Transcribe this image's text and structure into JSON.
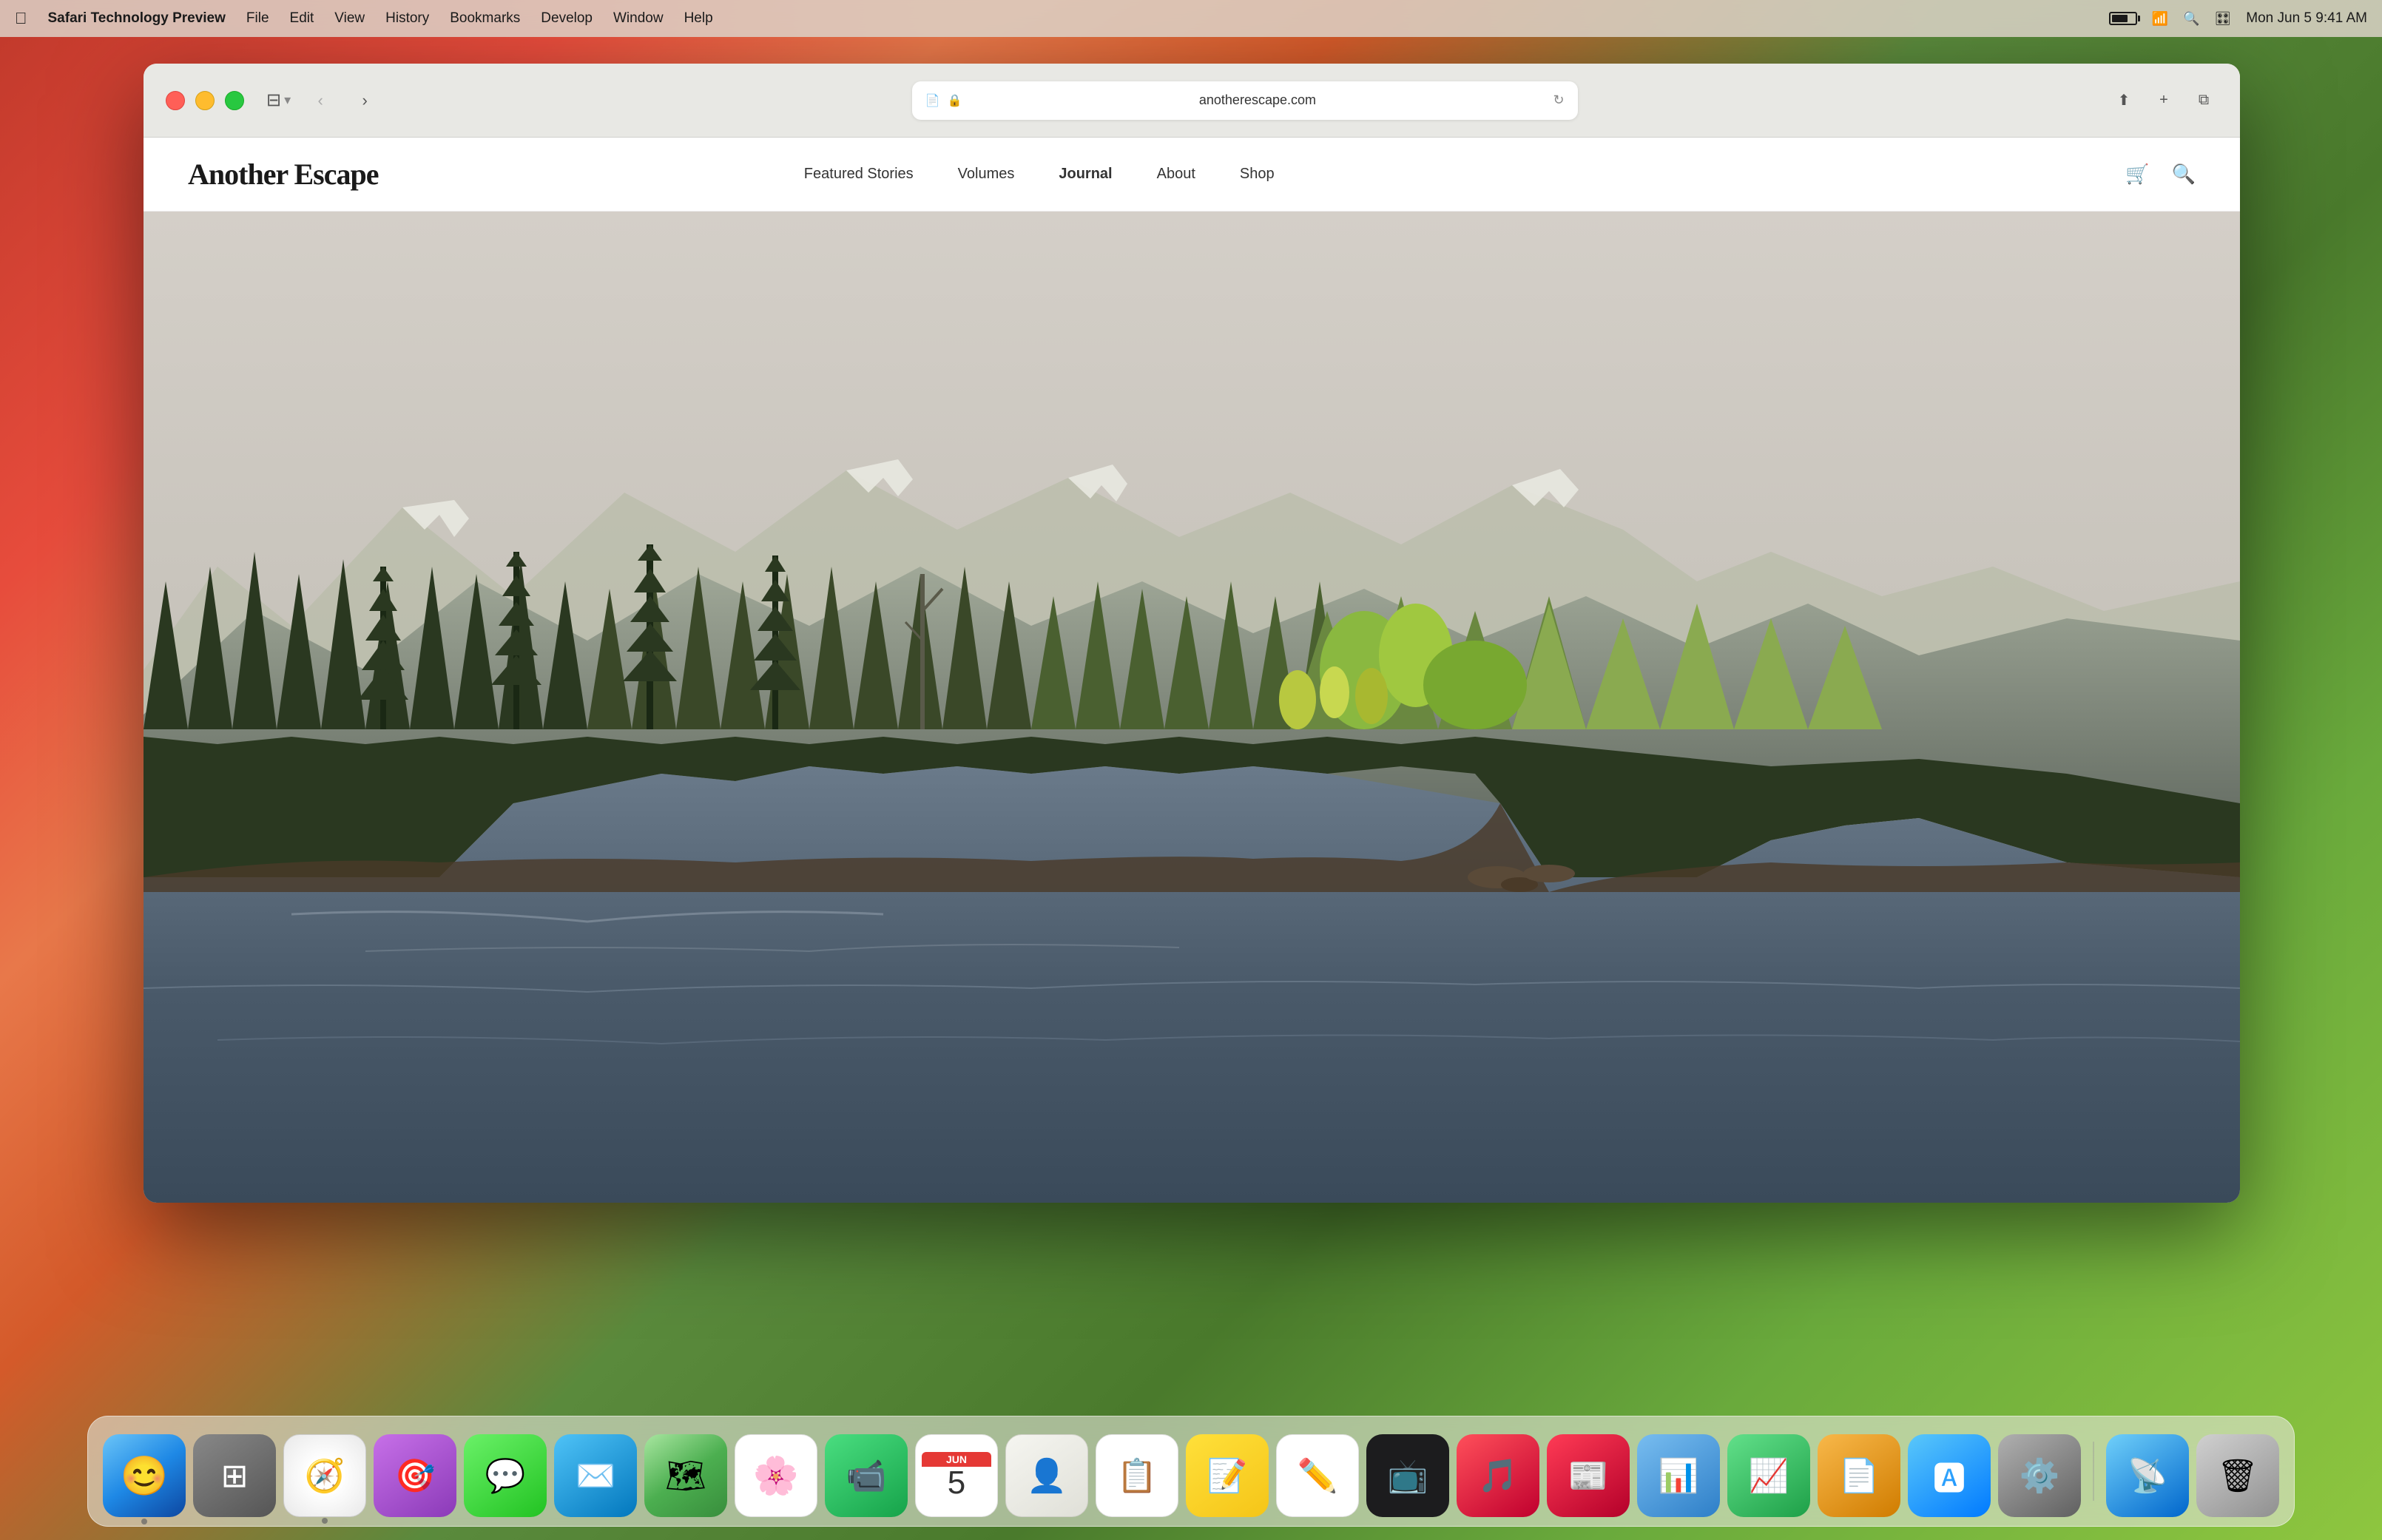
{
  "menubar": {
    "apple_label": "",
    "app_name": "Safari Technology Preview",
    "menus": [
      "File",
      "Edit",
      "View",
      "History",
      "Bookmarks",
      "Develop",
      "Window",
      "Help"
    ],
    "time": "Mon Jun 5  9:41 AM"
  },
  "browser": {
    "url": "anotherescape.com",
    "back_label": "‹",
    "forward_label": "›",
    "share_label": "⬆",
    "new_tab_label": "+",
    "tabs_label": "⧉"
  },
  "website": {
    "logo": "Another Escape",
    "nav": {
      "links": [
        "Featured Stories",
        "Volumes",
        "Journal",
        "About",
        "Shop"
      ]
    }
  },
  "dock": {
    "apps": [
      {
        "name": "Finder",
        "emoji": "🟦"
      },
      {
        "name": "Launchpad",
        "emoji": "🟣"
      },
      {
        "name": "Safari",
        "emoji": "🔵"
      },
      {
        "name": "Instruments",
        "emoji": "🟣"
      },
      {
        "name": "Messages",
        "emoji": "💬"
      },
      {
        "name": "Mail",
        "emoji": "📧"
      },
      {
        "name": "Maps",
        "emoji": "🗺"
      },
      {
        "name": "Photos",
        "emoji": "🌸"
      },
      {
        "name": "FaceTime",
        "emoji": "📹"
      },
      {
        "name": "Calendar",
        "emoji": "📅"
      },
      {
        "name": "Contacts",
        "emoji": "👤"
      },
      {
        "name": "Reminders",
        "emoji": "📋"
      },
      {
        "name": "Notes",
        "emoji": "📝"
      },
      {
        "name": "Freeform",
        "emoji": "✏️"
      },
      {
        "name": "Apple TV",
        "emoji": "📺"
      },
      {
        "name": "Music",
        "emoji": "🎵"
      },
      {
        "name": "News",
        "emoji": "📰"
      },
      {
        "name": "Keynote",
        "emoji": "📊"
      },
      {
        "name": "Numbers",
        "emoji": "📊"
      },
      {
        "name": "Pages",
        "emoji": "📄"
      },
      {
        "name": "App Store",
        "emoji": "🔵"
      },
      {
        "name": "System Preferences",
        "emoji": "⚙️"
      },
      {
        "name": "AirDrop",
        "emoji": "📡"
      },
      {
        "name": "Trash",
        "emoji": "🗑"
      }
    ]
  }
}
